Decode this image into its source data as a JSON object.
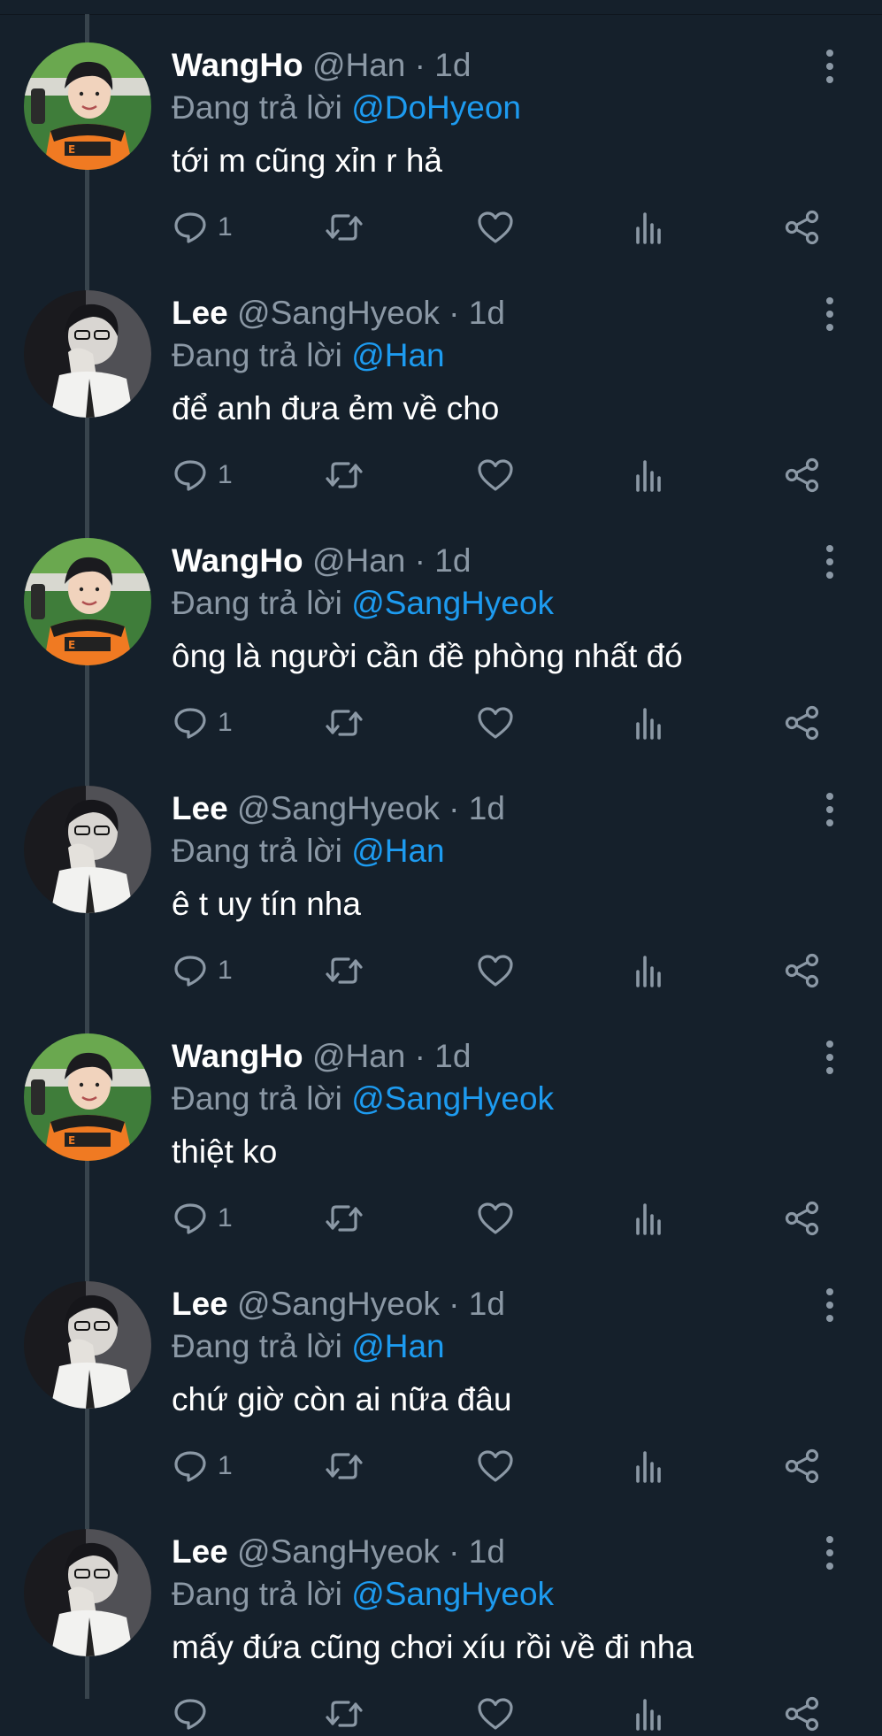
{
  "reply_prefix": "Đang trả lời",
  "time_separator": " · ",
  "colors": {
    "background": "#15202b",
    "text": "#ffffff",
    "secondary_text": "#8b98a5",
    "mention": "#1d9bf0",
    "thread_line": "#38444d"
  },
  "icons": [
    "more-vertical-icon",
    "reply-icon",
    "retweet-icon",
    "like-icon",
    "views-icon",
    "share-icon"
  ],
  "tweets": [
    {
      "name": "WangHo",
      "handle": "@Han",
      "time": "1d",
      "reply_to": "@DoHyeon",
      "text": "tới m cũng xỉn r hả",
      "reply_count": "1"
    },
    {
      "name": "Lee",
      "handle": "@SangHyeok",
      "time": "1d",
      "reply_to": "@Han",
      "text": "để anh đưa ẻm về cho",
      "reply_count": "1"
    },
    {
      "name": "WangHo",
      "handle": "@Han",
      "time": "1d",
      "reply_to": "@SangHyeok",
      "text": "ông là người cần đề phòng nhất đó",
      "reply_count": "1"
    },
    {
      "name": "Lee",
      "handle": "@SangHyeok",
      "time": "1d",
      "reply_to": "@Han",
      "text": "ê t uy tín nha",
      "reply_count": "1"
    },
    {
      "name": "WangHo",
      "handle": "@Han",
      "time": "1d",
      "reply_to": "@SangHyeok",
      "text": "thiệt ko",
      "reply_count": "1"
    },
    {
      "name": "Lee",
      "handle": "@SangHyeok",
      "time": "1d",
      "reply_to": "@Han",
      "text": "chứ giờ còn ai nữa đâu",
      "reply_count": "1"
    },
    {
      "name": "Lee",
      "handle": "@SangHyeok",
      "time": "1d",
      "reply_to": "@SangHyeok",
      "text": "mấy đứa cũng chơi xíu rồi về đi nha",
      "reply_count": ""
    }
  ]
}
